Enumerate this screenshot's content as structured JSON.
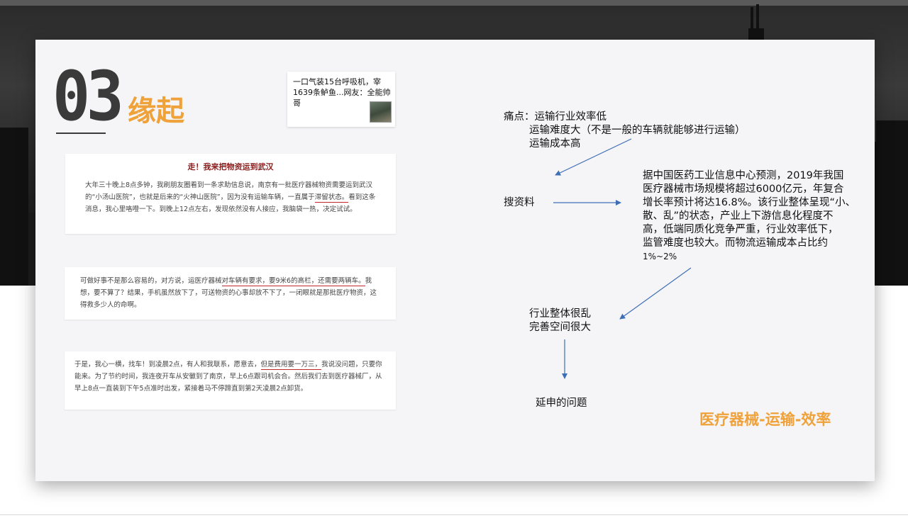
{
  "section": {
    "number": "03",
    "title": "缘起"
  },
  "news_card": {
    "text": "一口气装15台呼吸机，宰1639条鲈鱼...网友：全能帅哥",
    "thumb_icon": "person-photo-thumbnail"
  },
  "excerpts": [
    {
      "heading": "走！我来把物资运到武汉",
      "before": "大年三十晚上8点多钟，我刷朋友圈看到一条求助信息说，南京有一批医疗器械物资需要运到武汉的“小汤山医院”，也就是后来的“火神山医院”，因为没有运输车辆，一直属于",
      "highlight": "滞留状态。",
      "after": "看到这条消息，我心里咯噔一下。到晚上12点左右，发现依然没有人接应，我脑袋一热，决定试试。"
    },
    {
      "before": "可做好事不是那么容易的，对方说，运医疗器械",
      "highlight": "对车辆有要求，要9米6的高栏，还需要两辆车。",
      "after": "我想，要不算了？结果，手机虽然放下了，可送物资的心事却放不下了，一闭眼就是那批医疗物资，这得救多少人的命啊。"
    },
    {
      "before": "于是，我心一横，找车！到凌晨2点，有人和我联系，愿意去，",
      "highlight": "但是费用要一万三，",
      "after": "我说没问题，只要你能来。为了节约时间，我连夜开车从安徽到了南京，早上6点跟司机会合。然后我们去到医疗器械厂，从早上8点一直装到下午5点准时出发，紧接着马不停蹄直到第2天凌晨2点卸货。"
    }
  ],
  "pain_points": {
    "label": "痛点：",
    "items": [
      "运输行业效率低",
      "运输难度大（不是一般的车辆就能够进行运输）",
      "运输成本高"
    ]
  },
  "research_label": "搜资料",
  "research_text": [
    "据中国医药工业信息中心预测，2019年我国",
    "医疗器械市场规模将超过6000亿元，年复合",
    "增长率预计将达16.8%。该行业整体呈现“小、",
    "散、乱”的状态，产业上下游信息化程度不",
    "高，低端同质化竞争严重，行业效率低下，",
    "监管难度也较大。而物流运输成本占比约",
    "1%~2%"
  ],
  "conclusion": [
    "行业整体很乱",
    "完善空间很大"
  ],
  "extended_label": "延申的问题",
  "keyword_text": "医疗器械-运输-效率",
  "colors": {
    "accent_orange": "#f0a23a",
    "arrow_blue": "#3d6fb6",
    "heading_red": "#8b1a1a",
    "underline_red": "#c0262c"
  }
}
